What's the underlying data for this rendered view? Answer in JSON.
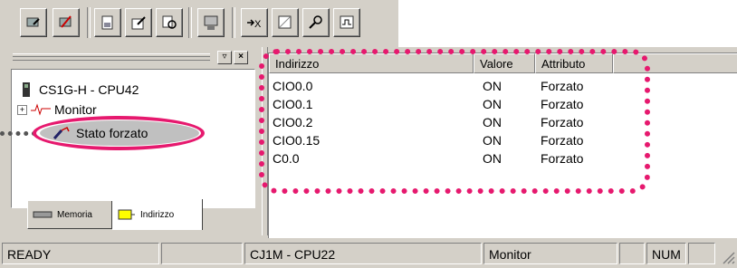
{
  "toolbar": {
    "buttons": [
      "online-icon",
      "offline-icon",
      "io-table-icon",
      "edit-icon",
      "compare-icon",
      "transfer-icon",
      "force-clear-icon",
      "search-icon",
      "force-icon",
      "monitor-icon"
    ]
  },
  "left_pane": {
    "tree": {
      "root": "CS1G-H - CPU42",
      "items": [
        "Monitor",
        "Stato forzato"
      ]
    },
    "tabs": [
      "Memoria",
      "Indirizzo"
    ]
  },
  "list": {
    "columns": [
      "Indirizzo",
      "Valore",
      "Attributo"
    ],
    "rows": [
      {
        "address": "CIO0.0",
        "value": "ON",
        "attribute": "Forzato"
      },
      {
        "address": "CIO0.1",
        "value": "ON",
        "attribute": "Forzato"
      },
      {
        "address": "CIO0.2",
        "value": "ON",
        "attribute": "Forzato"
      },
      {
        "address": "CIO0.15",
        "value": "ON",
        "attribute": "Forzato"
      },
      {
        "address": "C0.0",
        "value": "ON",
        "attribute": "Forzato"
      }
    ]
  },
  "statusbar": {
    "ready": "READY",
    "plc": "CJ1M - CPU22",
    "mode": "Monitor",
    "num": "NUM"
  },
  "colors": {
    "annotation": "#e6196e",
    "panel": "#d4d0c8"
  }
}
